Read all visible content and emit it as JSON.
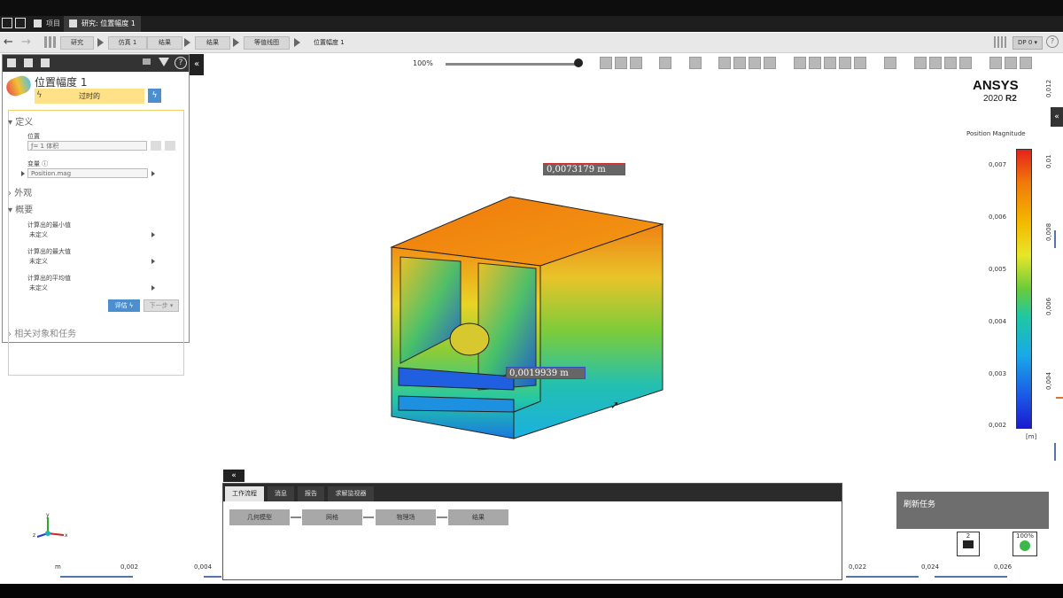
{
  "tabs": [
    {
      "label": "项目",
      "active": false
    },
    {
      "label": "研究: 位置幅度 1",
      "active": true
    }
  ],
  "breadcrumbs": [
    "研究",
    "仿真 1",
    "结果",
    "结果",
    "等值线图"
  ],
  "breadcrumb_current": "位置幅度 1",
  "dp_label": "DP 0 ▾",
  "help_symbol": "?",
  "toolbar": {
    "zoom": "100%"
  },
  "panel": {
    "title": "位置幅度 1",
    "status": "过时的",
    "sections": {
      "definition": "定义",
      "appearance": "外观",
      "summary": "概要",
      "related": "相关对象和任务"
    },
    "location_label": "位置",
    "location_value": "ƒ= 1 体积",
    "variable_label": "变量",
    "variable_value": "Position.mag",
    "min_label": "计算出的最小值",
    "min_value": "未定义",
    "max_label": "计算出的最大值",
    "max_value": "未定义",
    "avg_label": "计算出的平均值",
    "avg_value": "未定义",
    "evaluate_button": "评估",
    "next_button": "下一步 ▾",
    "collapse_symbol": "«"
  },
  "logo": {
    "brand": "ANSYS",
    "version": "2020",
    "release": "R2"
  },
  "legend": {
    "title": "Position Magnitude",
    "ticks": [
      "0,007",
      "0,006",
      "0,005",
      "0,004",
      "0,003",
      "0,002"
    ],
    "unit": "[m]",
    "colors": [
      "#e6221a",
      "#f07a0a",
      "#f4b800",
      "#e8e62a",
      "#6acb3a",
      "#1ec8a2",
      "#1aa8e8",
      "#1b5be6",
      "#1a1ad0"
    ]
  },
  "right_ruler": [
    "0,012",
    "0,01",
    "0,008",
    "0,006",
    "0,004"
  ],
  "bottom_ruler": [
    "m",
    "0,002",
    "0,004",
    "0,022",
    "0,024",
    "0,026"
  ],
  "probes": {
    "max": "0,0073179 m",
    "min": "0,0019939 m"
  },
  "bottom_panel": {
    "tabs": [
      "工作流程",
      "消息",
      "报告",
      "求解监视器"
    ],
    "workflow": [
      "几何模型",
      "网格",
      "物理场",
      "结果"
    ]
  },
  "refresh_tasks": "刷新任务",
  "message_count": "2",
  "progress": "100%",
  "axis_labels": {
    "y": "y",
    "x": "x",
    "z": "z"
  }
}
